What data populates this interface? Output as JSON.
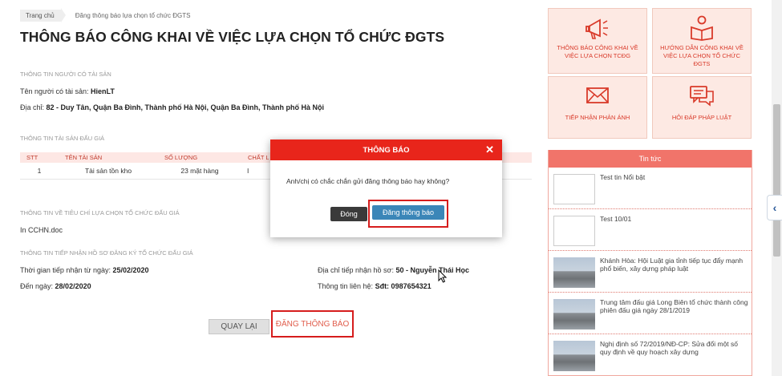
{
  "breadcrumb": {
    "home": "Trang chủ",
    "current": "Đăng thông báo lựa chọn tổ chức ĐGTS"
  },
  "page_title": "THÔNG BÁO CÔNG KHAI VỀ VIỆC LỰA CHỌN TỔ CHỨC ĐGTS",
  "owner": {
    "section": "THÔNG TIN NGƯỜI CÓ TÀI SẢN",
    "name_label": "Tên người có tài sản:",
    "name_value": "HienLT",
    "addr_label": "Địa chỉ:",
    "addr_value": "82 - Duy Tân, Quận Ba Đình, Thành phố Hà Nội, Quận Ba Đình, Thành phố Hà Nội"
  },
  "asset": {
    "section": "THÔNG TIN TÀI SẢN ĐẤU GIÁ",
    "headers": [
      "STT",
      "TÊN TÀI SẢN",
      "SỐ LƯỢNG",
      "CHẤT L"
    ],
    "row": [
      "1",
      "Tài sản tồn kho",
      "23 mặt hàng",
      "I"
    ]
  },
  "criteria": {
    "section": "THÔNG TIN VỀ TIÊU CHÍ LỰA CHỌN TỔ CHỨC ĐẤU GIÁ",
    "file": "In CCHN.doc"
  },
  "receipt": {
    "section": "THÔNG TIN TIẾP NHẬN HỒ SƠ ĐĂNG KÝ TỔ CHỨC ĐẤU GIÁ",
    "from_label": "Thời gian tiếp nhận từ ngày:",
    "from_value": "25/02/2020",
    "to_label": "Đến ngày:",
    "to_value": "28/02/2020",
    "addr_label": "Địa chỉ tiếp nhận hồ sơ:",
    "addr_value": "50 - Nguyễn Thái Học",
    "contact_label": "Thông tin liên hệ:",
    "contact_value": "Sđt: 0987654321"
  },
  "buttons": {
    "back": "QUAY LẠI",
    "publish": "ĐĂNG THÔNG BÁO"
  },
  "tiles": [
    {
      "label": "THÔNG BÁO CÔNG KHAI VỀ VIỆC LỰA CHỌN TCĐG",
      "icon": "megaphone-icon"
    },
    {
      "label": "HƯỚNG DẪN CÔNG KHAI VỀ VIỆC LỰA CHỌN TỔ CHỨC ĐGTS",
      "icon": "person-reading-icon"
    },
    {
      "label": "TIẾP NHẬN PHẢN ÁNH",
      "icon": "envelope-icon"
    },
    {
      "label": "HỎI ĐÁP PHÁP LUẬT",
      "icon": "chat-bubbles-icon"
    }
  ],
  "news": {
    "header": "Tin tức",
    "items": [
      {
        "title": "Test tin Nổi bật"
      },
      {
        "title": "Test 10/01"
      },
      {
        "title": "Khánh Hòa: Hội Luật gia tỉnh tiếp tục đẩy mạnh phổ biến, xây dựng pháp luật"
      },
      {
        "title": "Trung tâm đấu giá Long Biên tổ chức thành công phiên đấu giá ngày 28/1/2019"
      },
      {
        "title": "Nghị định số 72/2019/NĐ-CP: Sửa đổi một số quy định về quy hoạch xây dựng"
      }
    ]
  },
  "modal": {
    "title": "THÔNG BÁO",
    "close": "✕",
    "message": "Anh/chị có chắc chắn gửi đăng thông báo hay không?",
    "cancel": "Đóng",
    "confirm": "Đăng thông báo"
  },
  "colors": {
    "accent": "#e8251b",
    "confirm": "#3b86b8",
    "tile_bg": "#fde9e3",
    "tile_text": "#d93a2a"
  }
}
